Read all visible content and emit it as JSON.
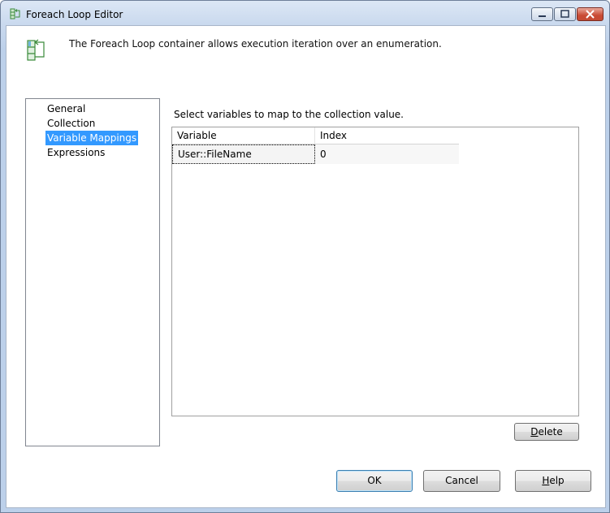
{
  "window": {
    "title": "Foreach Loop Editor"
  },
  "header": {
    "description": "The Foreach Loop container allows execution iteration over an enumeration."
  },
  "nav": {
    "items": [
      {
        "label": "General",
        "selected": false
      },
      {
        "label": "Collection",
        "selected": false
      },
      {
        "label": "Variable Mappings",
        "selected": true
      },
      {
        "label": "Expressions",
        "selected": false
      }
    ]
  },
  "main": {
    "instruction": "Select variables to map to the collection value.",
    "grid": {
      "columns": [
        "Variable",
        "Index"
      ],
      "rows": [
        {
          "variable": "User::FileName",
          "index": "0"
        }
      ]
    }
  },
  "buttons": {
    "delete": {
      "first": "D",
      "rest": "elete"
    },
    "ok": "OK",
    "cancel": "Cancel",
    "help": {
      "first": "H",
      "rest": "elp"
    }
  },
  "colors": {
    "selection": "#3399ff",
    "titlebar": "#c9d9ee",
    "close_button": "#c94a33"
  }
}
